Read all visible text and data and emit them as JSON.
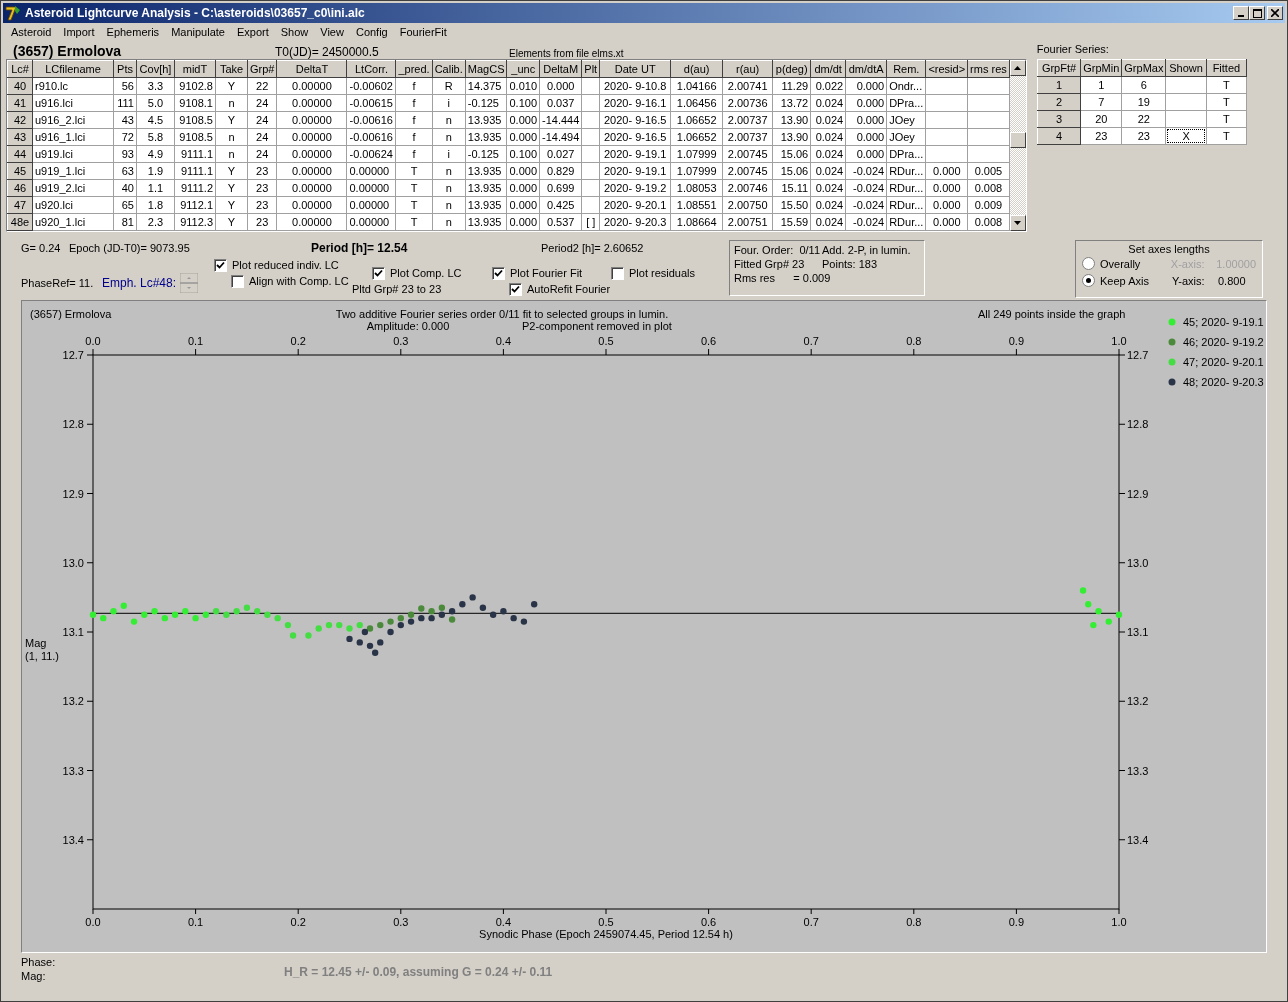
{
  "window": {
    "title": "Asteroid Lightcurve Analysis - C:\\asteroids\\03657_c0\\ini.alc"
  },
  "menu": [
    "Asteroid",
    "Import",
    "Ephemeris",
    "Manipulate",
    "Export",
    "Show",
    "View",
    "Config",
    "FourierFit"
  ],
  "header": {
    "asteroid": "(3657) Ermolova",
    "t0": "T0(JD)= 2450000.5",
    "elements": "Elements from file elms.xt"
  },
  "lc_table": {
    "columns": [
      "Lc#",
      "LCfilename",
      "Pts",
      "Cov[h]",
      "midT",
      "Take",
      "Grp#",
      "DeltaT",
      "LtCorr.",
      "_pred.",
      "Calib.",
      "MagCS",
      "_unc",
      "DeltaM",
      "Plt",
      "Date UT",
      "d(au)",
      "r(au)",
      "p(deg)",
      "dm/dt",
      "dm/dtA",
      "Rem.",
      "<resid>",
      "rms res"
    ],
    "rows": [
      [
        "40",
        "r910.lc",
        "56",
        "3.3",
        "9102.8",
        "Y",
        "22",
        "0.00000",
        "-0.00602",
        "f",
        "R",
        "14.375",
        "0.010",
        "0.000",
        null,
        "2020- 9-10.8",
        "1.04166",
        "2.00741",
        "11.29",
        "0.022",
        "0.000",
        "Ondr...",
        null,
        null
      ],
      [
        "41",
        "u916.lci",
        "111",
        "5.0",
        "9108.1",
        "n",
        "24",
        "0.00000",
        "-0.00615",
        "f",
        "i",
        "-0.125",
        "0.100",
        "0.037",
        null,
        "2020- 9-16.1",
        "1.06456",
        "2.00736",
        "13.72",
        "0.024",
        "0.000",
        "DPra...",
        null,
        null
      ],
      [
        "42",
        "u916_2.lci",
        "43",
        "4.5",
        "9108.5",
        "Y",
        "24",
        "0.00000",
        "-0.00616",
        "f",
        "n",
        "13.935",
        "0.000",
        "-14.444",
        null,
        "2020- 9-16.5",
        "1.06652",
        "2.00737",
        "13.90",
        "0.024",
        "0.000",
        "JOey",
        null,
        null
      ],
      [
        "43",
        "u916_1.lci",
        "72",
        "5.8",
        "9108.5",
        "n",
        "24",
        "0.00000",
        "-0.00616",
        "f",
        "n",
        "13.935",
        "0.000",
        "-14.494",
        null,
        "2020- 9-16.5",
        "1.06652",
        "2.00737",
        "13.90",
        "0.024",
        "0.000",
        "JOey",
        null,
        null
      ],
      [
        "44",
        "u919.lci",
        "93",
        "4.9",
        "9111.1",
        "n",
        "24",
        "0.00000",
        "-0.00624",
        "f",
        "i",
        "-0.125",
        "0.100",
        "0.027",
        null,
        "2020- 9-19.1",
        "1.07999",
        "2.00745",
        "15.06",
        "0.024",
        "0.000",
        "DPra...",
        null,
        null
      ],
      [
        "45",
        "u919_1.lci",
        "63",
        "1.9",
        "9111.1",
        "Y",
        "23",
        "0.00000",
        "0.00000",
        "T",
        "n",
        "13.935",
        "0.000",
        "0.829",
        null,
        "2020- 9-19.1",
        "1.07999",
        "2.00745",
        "15.06",
        "0.024",
        "-0.024",
        "RDur...",
        "0.000",
        "0.005"
      ],
      [
        "46",
        "u919_2.lci",
        "40",
        "1.1",
        "9111.2",
        "Y",
        "23",
        "0.00000",
        "0.00000",
        "T",
        "n",
        "13.935",
        "0.000",
        "0.699",
        null,
        "2020- 9-19.2",
        "1.08053",
        "2.00746",
        "15.11",
        "0.024",
        "-0.024",
        "RDur...",
        "0.000",
        "0.008"
      ],
      [
        "47",
        "u920.lci",
        "65",
        "1.8",
        "9112.1",
        "Y",
        "23",
        "0.00000",
        "0.00000",
        "T",
        "n",
        "13.935",
        "0.000",
        "0.425",
        null,
        "2020- 9-20.1",
        "1.08551",
        "2.00750",
        "15.50",
        "0.024",
        "-0.024",
        "RDur...",
        "0.000",
        "0.009"
      ],
      [
        "48e",
        "u920_1.lci",
        "81",
        "2.3",
        "9112.3",
        "Y",
        "23",
        "0.00000",
        "0.00000",
        "T",
        "n",
        "13.935",
        "0.000",
        "0.537",
        "[ ]",
        "2020- 9-20.3",
        "1.08664",
        "2.00751",
        "15.59",
        "0.024",
        "-0.024",
        "RDur...",
        "0.000",
        "0.008"
      ]
    ]
  },
  "fourier_series": {
    "title": "Fourier Series:",
    "columns": [
      "GrpFt#",
      "GrpMin",
      "GrpMax",
      "Shown",
      "Fitted"
    ],
    "rows": [
      [
        "1",
        "1",
        "6",
        null,
        "T"
      ],
      [
        "2",
        "7",
        "19",
        null,
        "T"
      ],
      [
        "3",
        "20",
        "22",
        null,
        "T"
      ],
      [
        "4",
        "23",
        "23",
        "X",
        "T"
      ]
    ]
  },
  "summary": {
    "g": "G= 0.24",
    "epoch": "Epoch (JD-T0)= 9073.95",
    "period": "Period [h]= 12.54",
    "period2": "Period2 [h]= 2.60652",
    "phase_ref": "PhaseRef= 11.",
    "emph": "Emph. Lc#48:",
    "pltd_grp": "Pltd Grp#  23 to   23"
  },
  "checkboxes": [
    {
      "label": "Plot reduced indiv. LC",
      "checked": true
    },
    {
      "label": "Align with Comp. LC",
      "checked": false
    },
    {
      "label": "Plot Comp. LC",
      "checked": true
    },
    {
      "label": "Plot Fourier Fit",
      "checked": true
    },
    {
      "label": "AutoRefit Fourier",
      "checked": true
    },
    {
      "label": "Plot residuals",
      "checked": false
    }
  ],
  "fit_info": [
    "Four. Order:  0/11",
    "Add. 2-P, in lumin.",
    "Fitted Grp# 23",
    "Points: 183",
    "Rms res      = 0.009"
  ],
  "axes_lengths": {
    "title": "Set axes lengths",
    "options": [
      {
        "label": "Overally",
        "selected": false
      },
      {
        "label": "Keep Axis",
        "selected": true
      }
    ],
    "fields": [
      {
        "label": "X-axis:",
        "value": "1.00000",
        "disabled": true
      },
      {
        "label": "Y-axis:",
        "value": "0.800",
        "disabled": false
      }
    ]
  },
  "plot": {
    "object": "(3657) Ermolova",
    "title": "Two additive Fourier series order 0/11 fit to selected groups in lumin.",
    "amplitude": "Amplitude: 0.000",
    "note": "P2-component removed in plot",
    "count": "All 249 points inside the graph",
    "ylabel_sub": "(1, 11.)",
    "chart_data": {
      "type": "scatter",
      "xlabel": "Synodic Phase (Epoch 2459074.45, Period 12.54 h)",
      "ylabel": "Mag",
      "xlim": [
        0,
        1
      ],
      "ylim": [
        13.5,
        12.7
      ],
      "xticks": [
        {
          "value": 0,
          "label": "0.0"
        },
        {
          "value": 0.1,
          "label": "0.1"
        },
        {
          "value": 0.2,
          "label": "0.2"
        },
        {
          "value": 0.3,
          "label": "0.3"
        },
        {
          "value": 0.4,
          "label": "0.4"
        },
        {
          "value": 0.5,
          "label": "0.5"
        },
        {
          "value": 0.6,
          "label": "0.6"
        },
        {
          "value": 0.7,
          "label": "0.7"
        },
        {
          "value": 0.8,
          "label": "0.8"
        },
        {
          "value": 0.9,
          "label": "0.9"
        },
        {
          "value": 1,
          "label": "1.0"
        }
      ],
      "yticks": [
        {
          "value": 12.7,
          "label": "12.7"
        },
        {
          "value": 12.8,
          "label": "12.8"
        },
        {
          "value": 12.9,
          "label": "12.9"
        },
        {
          "value": 13,
          "label": "13.0"
        },
        {
          "value": 13.1,
          "label": "13.1"
        },
        {
          "value": 13.2,
          "label": "13.2"
        },
        {
          "value": 13.3,
          "label": "13.3"
        },
        {
          "value": 13.4,
          "label": "13.4"
        }
      ],
      "ref_lines": [
        {
          "axis": "y",
          "value": 13.073
        }
      ],
      "legend": true,
      "series": [
        {
          "name": "45; 2020- 9-19.1",
          "color": "#33ee33",
          "x": [
            0,
            0.01,
            0.02,
            0.03,
            0.04,
            0.05,
            0.06,
            0.07,
            0.08,
            0.09,
            0.1,
            0.11,
            0.965,
            0.97,
            0.975,
            0.98,
            0.99,
            1
          ],
          "values": [
            13.075,
            13.08,
            13.07,
            13.062,
            13.085,
            13.075,
            13.07,
            13.08,
            13.075,
            13.07,
            13.08,
            13.075,
            13.04,
            13.06,
            13.09,
            13.07,
            13.085,
            13.075
          ]
        },
        {
          "name": "46; 2020- 9-19.2",
          "color": "#4a8a3a",
          "x": [
            0.27,
            0.28,
            0.29,
            0.3,
            0.31,
            0.32,
            0.33,
            0.34,
            0.35
          ],
          "values": [
            13.095,
            13.09,
            13.085,
            13.08,
            13.075,
            13.066,
            13.07,
            13.065,
            13.082
          ]
        },
        {
          "name": "47; 2020- 9-20.1",
          "color": "#44dd44",
          "x": [
            0.12,
            0.13,
            0.14,
            0.15,
            0.16,
            0.17,
            0.18,
            0.19,
            0.195,
            0.21,
            0.22,
            0.23,
            0.24,
            0.25,
            0.26
          ],
          "values": [
            13.07,
            13.075,
            13.07,
            13.065,
            13.07,
            13.075,
            13.08,
            13.09,
            13.105,
            13.105,
            13.095,
            13.09,
            13.09,
            13.095,
            13.09
          ]
        },
        {
          "name": "48; 2020- 9-20.3",
          "color": "#2a3448",
          "x": [
            0.25,
            0.26,
            0.265,
            0.27,
            0.275,
            0.28,
            0.29,
            0.3,
            0.31,
            0.32,
            0.33,
            0.34,
            0.35,
            0.36,
            0.37,
            0.38,
            0.39,
            0.4,
            0.41,
            0.42,
            0.43
          ],
          "values": [
            13.11,
            13.115,
            13.1,
            13.12,
            13.13,
            13.115,
            13.1,
            13.09,
            13.085,
            13.08,
            13.08,
            13.075,
            13.07,
            13.06,
            13.05,
            13.065,
            13.075,
            13.07,
            13.08,
            13.085,
            13.06
          ]
        }
      ]
    }
  },
  "status": {
    "phase": "Phase:",
    "mag": "Mag:",
    "result": "H_R = 12.45 +/- 0.09, assuming G = 0.24 +/- 0.11"
  }
}
